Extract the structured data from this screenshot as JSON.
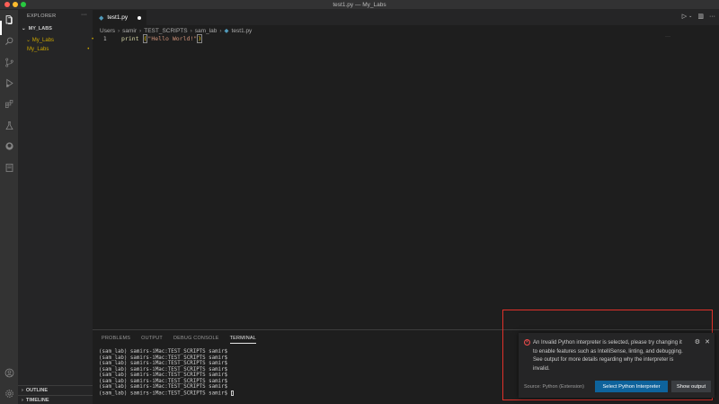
{
  "window": {
    "title": "test1.py — My_Labs"
  },
  "traffic_colors": {
    "close": "#ff5f57",
    "minimize": "#febc2e",
    "maximize": "#28c840"
  },
  "activity_bar": {
    "icons": [
      "explorer-icon",
      "search-icon",
      "source-control-icon",
      "run-debug-icon",
      "extensions-icon",
      "testing-icon",
      "github-icon",
      "notebook-icon",
      "account-icon",
      "manage-gear-icon"
    ]
  },
  "sidebar": {
    "header": "EXPLORER",
    "more": "···",
    "workspace": "MY_LABS",
    "items": [
      {
        "label": "My_Labs",
        "badge": "•"
      },
      {
        "label": "My_Labs",
        "badge": "•"
      }
    ],
    "outline": "OUTLINE",
    "timeline": "TIMELINE"
  },
  "editor": {
    "tab": {
      "label": "test1.py",
      "icon": "python-file-icon"
    },
    "breadcrumb": [
      "Users",
      "samir",
      "TEST_SCRIPTS",
      "sam_lab",
      "test1.py"
    ],
    "line_number": "1",
    "code": {
      "keyword": "print",
      "open": "(",
      "string": "\"Hello World!\"",
      "close": ")"
    }
  },
  "panel": {
    "tabs": [
      "PROBLEMS",
      "OUTPUT",
      "DEBUG CONSOLE",
      "TERMINAL"
    ],
    "active_tab": "TERMINAL",
    "terminal_lines": [
      "(sam_lab) samirs-iMac:TEST_SCRIPTS samir$",
      "(sam_lab) samirs-iMac:TEST_SCRIPTS samir$",
      "(sam_lab) samirs-iMac:TEST_SCRIPTS samir$",
      "(sam_lab) samirs-iMac:TEST_SCRIPTS samir$",
      "(sam_lab) samirs-iMac:TEST_SCRIPTS samir$",
      "(sam_lab) samirs-iMac:TEST_SCRIPTS samir$",
      "(sam_lab) samirs-iMac:TEST_SCRIPTS samir$",
      "(sam_lab) samirs-iMac:TEST_SCRIPTS samir$"
    ]
  },
  "notification": {
    "message": "An Invalid Python interpreter is selected, please try changing it to enable features such as IntelliSense, linting, and debugging. See output for more details regarding why the interpreter is invalid.",
    "source": "Source: Python (Extension)",
    "primary_button": "Select Python Interpreter",
    "secondary_button": "Show output",
    "icon": "error-icon"
  }
}
